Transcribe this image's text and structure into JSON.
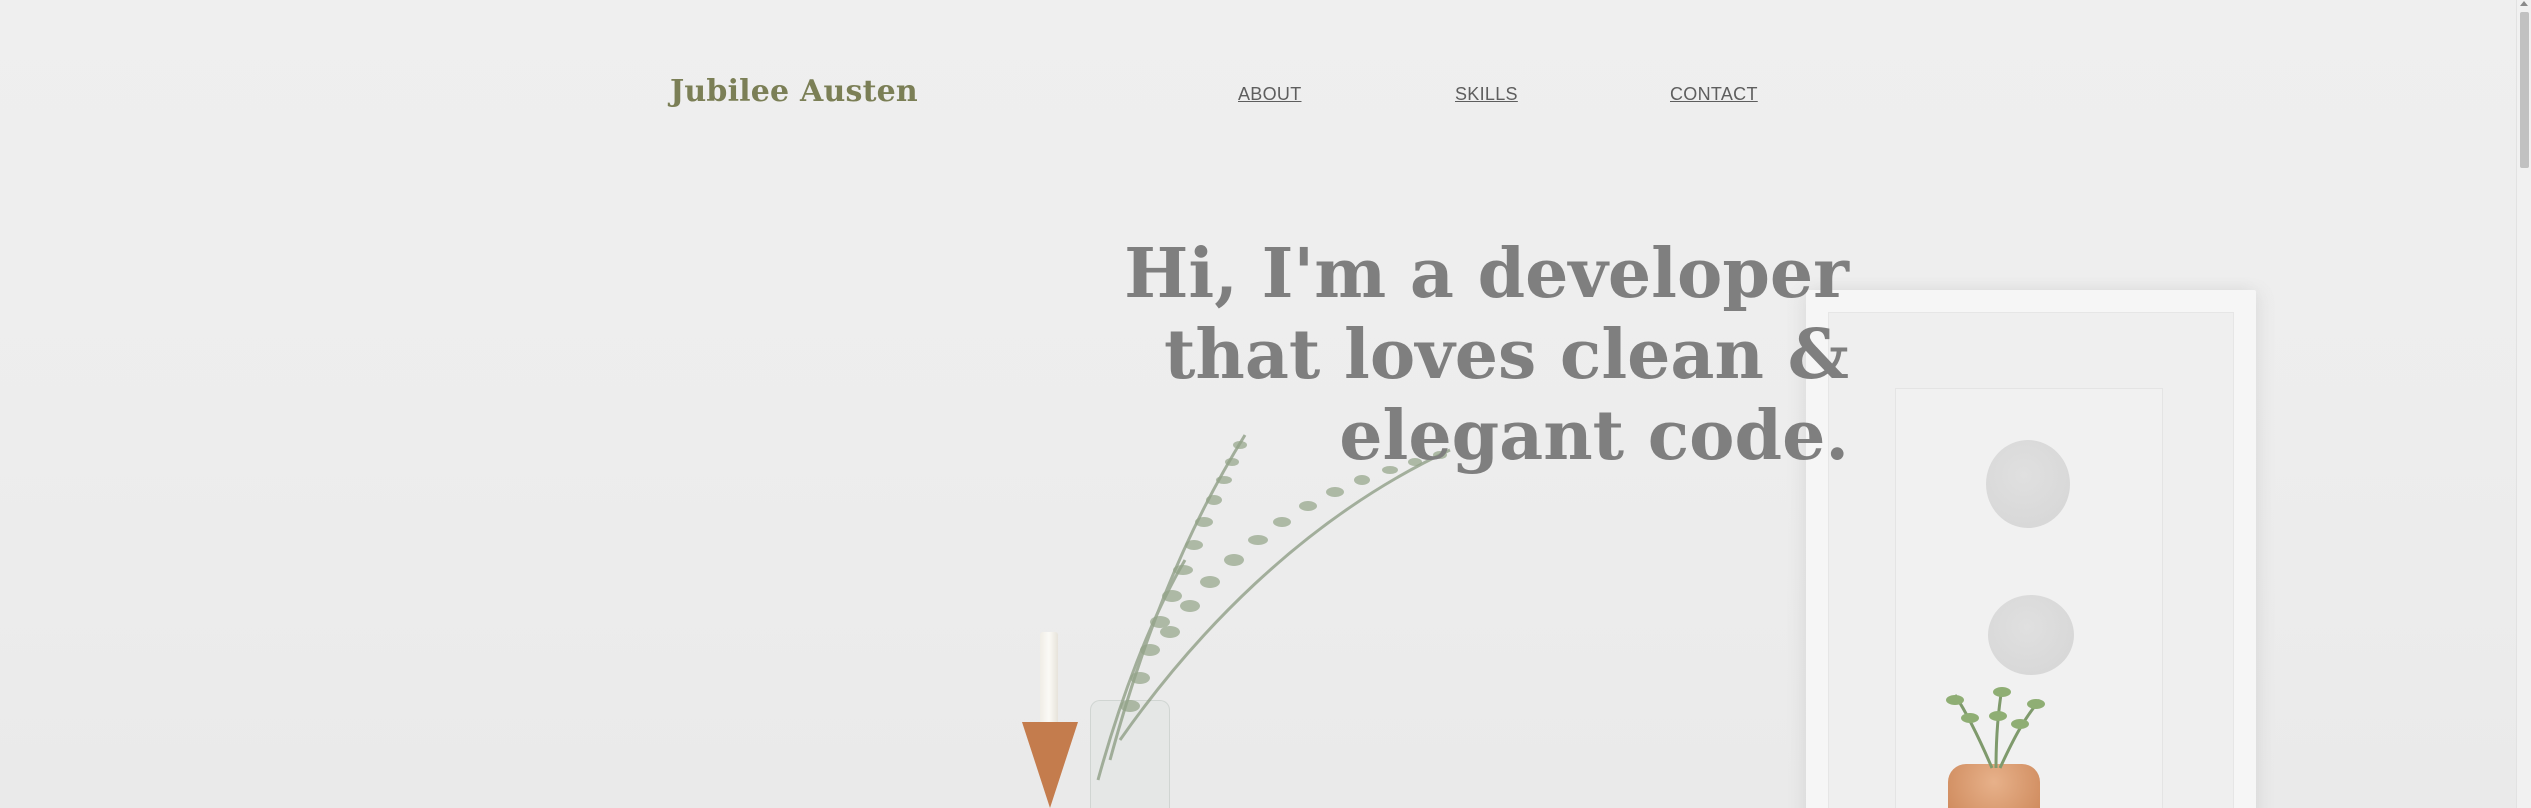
{
  "header": {
    "logo": "Jubilee Austen",
    "nav": [
      {
        "label": "ABOUT"
      },
      {
        "label": "SKILLS"
      },
      {
        "label": "CONTACT"
      }
    ]
  },
  "hero": {
    "lines": [
      "Hi, I'm a developer",
      "that loves clean &",
      "elegant code."
    ]
  },
  "colors": {
    "logo": "#7b7f56",
    "hero_text": "#7f7f7f",
    "nav_text": "#5e5e5e",
    "background": "#ededed"
  }
}
